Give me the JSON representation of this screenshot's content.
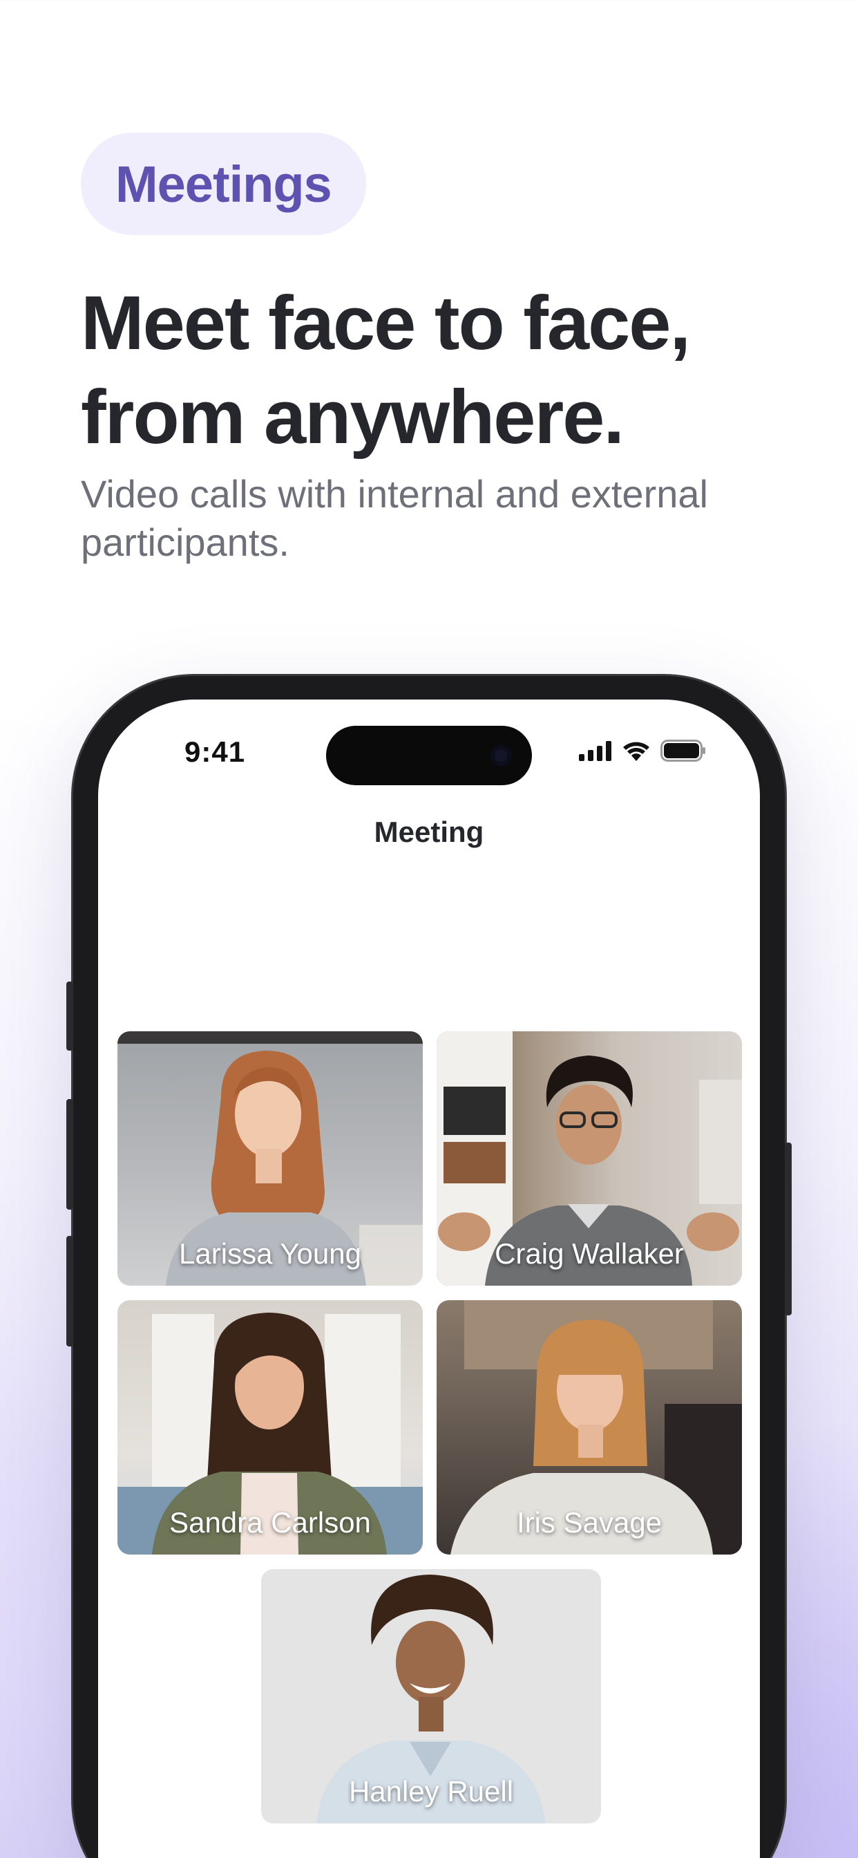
{
  "hero": {
    "tag": "Meetings",
    "headline": "Meet face to face, from anywhere.",
    "subline": "Video calls with internal and external participants."
  },
  "phone": {
    "status_time": "9:41",
    "screen_title": "Meeting",
    "status_icons": [
      "signal-icon",
      "wifi-icon",
      "battery-icon"
    ]
  },
  "participants": [
    {
      "name": "Larissa Young"
    },
    {
      "name": "Craig Wallaker"
    },
    {
      "name": "Sandra Carlson"
    },
    {
      "name": "Iris Savage"
    },
    {
      "name": "Hanley Ruell"
    }
  ],
  "colors": {
    "accent": "#5e52b0",
    "tag_bg": "#f0edfc",
    "headline": "#25272d",
    "subline": "#6d7079"
  }
}
